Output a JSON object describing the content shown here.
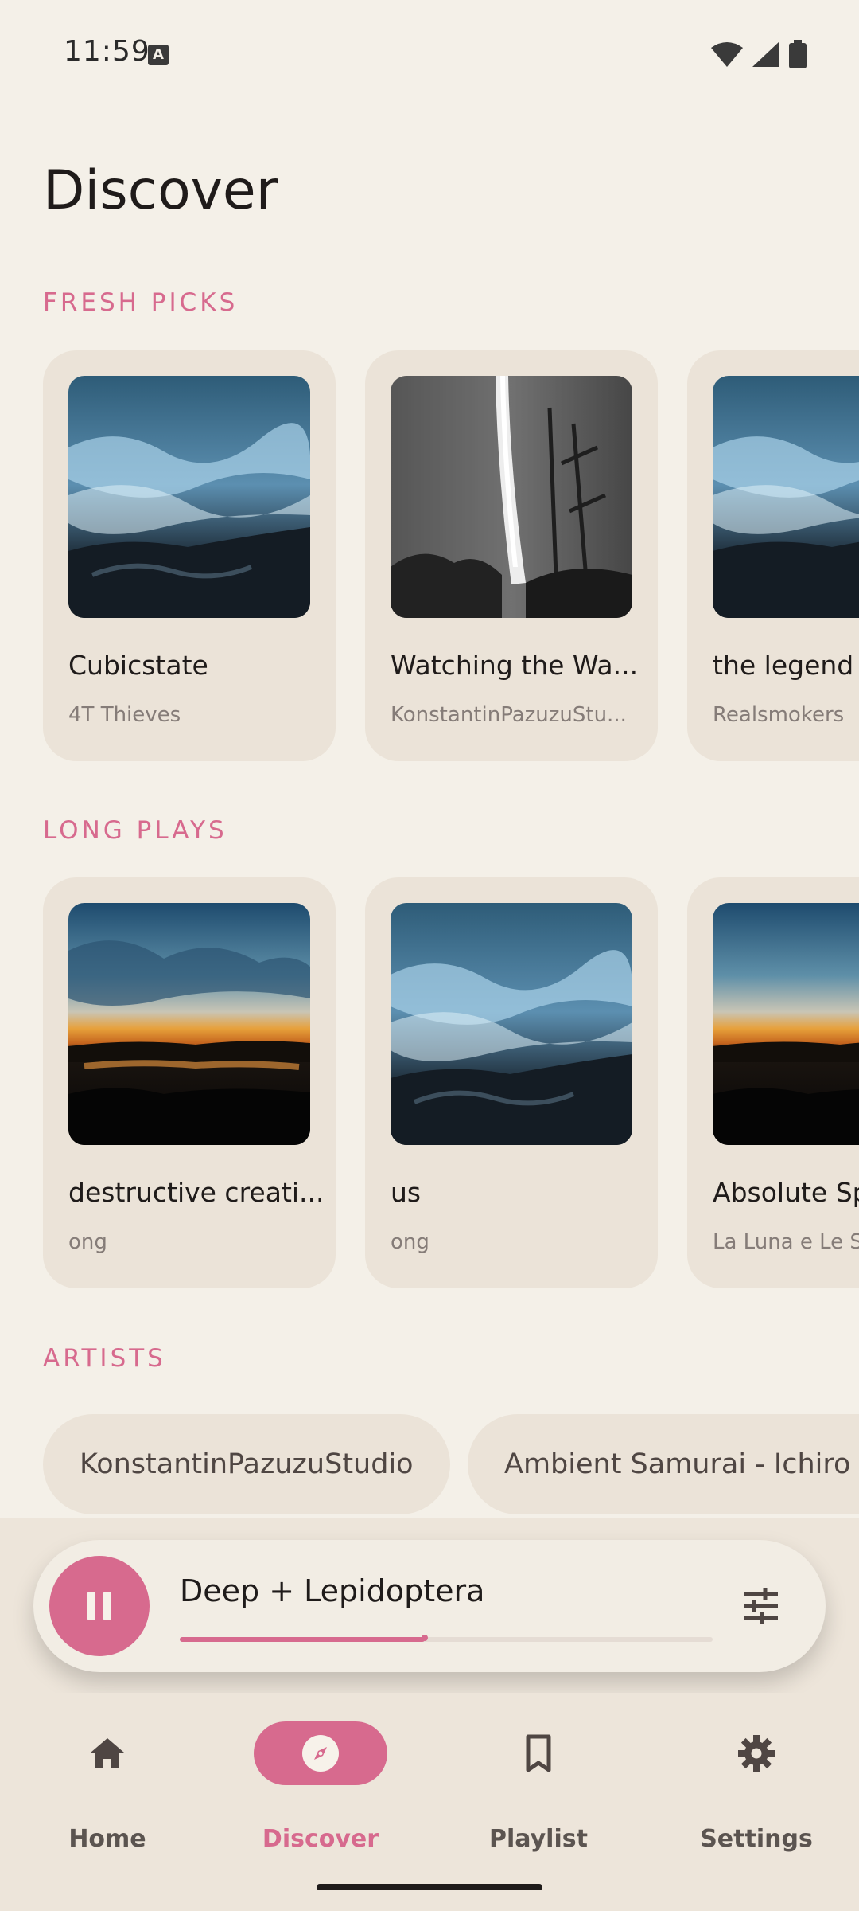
{
  "status_bar": {
    "time": "11:59",
    "keyboard_indicator": "A",
    "icons": [
      "wifi-icon",
      "signal-icon",
      "battery-icon"
    ]
  },
  "page_title": "Discover",
  "sections": {
    "fresh_picks": {
      "label": "FRESH PICKS",
      "items": [
        {
          "title": "Cubicstate",
          "subtitle": "4T Thieves",
          "art": "ocean-waves"
        },
        {
          "title": "Watching the Wa...",
          "subtitle": "KonstantinPazuzuStu...",
          "art": "waterfall"
        },
        {
          "title": "the legend",
          "subtitle": "Realsmokers",
          "art": "ocean-waves"
        }
      ]
    },
    "long_plays": {
      "label": "LONG PLAYS",
      "items": [
        {
          "title": "destructive creati...",
          "subtitle": "ong",
          "art": "sunset-lake"
        },
        {
          "title": "us",
          "subtitle": "ong",
          "art": "ocean-waves"
        },
        {
          "title": "Absolute Sp",
          "subtitle": "La Luna e Le S",
          "art": "sunset-lake"
        }
      ]
    },
    "artists": {
      "label": "ARTISTS",
      "items": [
        "KonstantinPazuzuStudio",
        "Ambient Samurai - Ichiro N"
      ]
    }
  },
  "player": {
    "title": "Deep + Lepidoptera",
    "progress": 0.46,
    "play_state": "playing"
  },
  "nav": {
    "items": [
      {
        "label": "Home",
        "icon": "home-icon"
      },
      {
        "label": "Discover",
        "icon": "compass-icon",
        "active": true
      },
      {
        "label": "Playlist",
        "icon": "bookmark-icon"
      },
      {
        "label": "Settings",
        "icon": "gear-icon"
      }
    ]
  },
  "colors": {
    "accent": "#D76A8E",
    "background": "#F4F0E8",
    "card": "#EBE3D8"
  }
}
